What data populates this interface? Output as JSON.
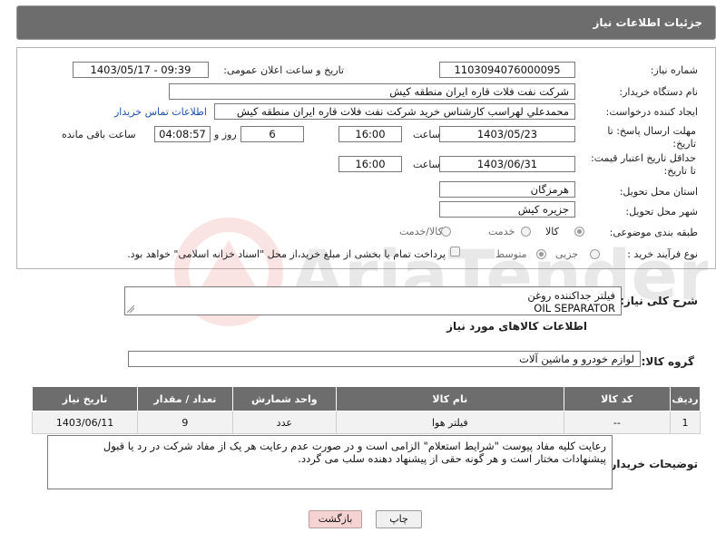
{
  "header": {
    "title": "جزئیات اطلاعات نیاز"
  },
  "form": {
    "need_number_label": "شماره نیاز:",
    "need_number": "1103094076000095",
    "announce_label": "تاریخ و ساعت اعلان عمومی:",
    "announce_value": "1403/05/17 - 09:39",
    "buyer_org_label": "نام دستگاه خریدار:",
    "buyer_org": "شرکت نفت فلات قاره ایران منطقه کیش",
    "creator_label": "ایجاد کننده درخواست:",
    "creator": "محمدعلي لهراسب كارشناس خريد شرکت نفت فلات قاره ایران منطقه کیش",
    "contact_link": "اطلاعات تماس خریدار",
    "reply_deadline_label": "مهلت ارسال پاسخ: تا تاریخ:",
    "reply_date": "1403/05/23",
    "time_word": "ساعت",
    "reply_time": "16:00",
    "days_value": "6",
    "days_and": "روز و",
    "remaining_time": "04:08:57",
    "remaining_label": "ساعت باقی مانده",
    "price_deadline_label": "حداقل تاریخ اعتبار قیمت: تا تاریخ:",
    "price_date": "1403/06/31",
    "price_time": "16:00",
    "province_label": "استان محل تحویل:",
    "province": "هرمزگان",
    "city_label": "شهر محل تحویل:",
    "city": "جزیره کیش",
    "category_label": "طبقه بندی موضوعی:",
    "category_options": [
      "کالا",
      "خدمت",
      "کالا/خدمت"
    ],
    "process_label": "نوع فرآیند خرید :",
    "process_options": [
      "جزیی",
      "متوسط"
    ],
    "payment_note": "پرداخت تمام یا بخشی از مبلغ خرید،از محل \"اسناد خزانه اسلامی\" خواهد بود."
  },
  "description": {
    "label": "شرح کلی نیاز:",
    "line1": "فیلتر جداکننده روغن",
    "line2": "OIL SEPARATOR"
  },
  "goods_info": {
    "title": "اطلاعات کالاهای مورد نیاز"
  },
  "goods_group": {
    "label": "گروه کالا:",
    "value": "لوازم خودرو و ماشین آلات"
  },
  "table": {
    "headers": [
      "ردیف",
      "کد کالا",
      "نام کالا",
      "واحد شمارش",
      "تعداد / مقدار",
      "تاریخ نیاز"
    ],
    "rows": [
      [
        "1",
        "--",
        "فیلتر هوا",
        "عدد",
        "9",
        "1403/06/11"
      ]
    ]
  },
  "buyer_notes": {
    "label": "توضیحات خریدار:",
    "line1": "رعایت کلیه مفاد  پیوست \"شرایط استعلام\" الزامی است و در صورت عدم رعایت هر یک از مفاد شرکت در رد یا قبول",
    "line2": "پیشنهادات مختار است  و هر گونه حقی از پیشنهاد دهنده سلب می گردد."
  },
  "buttons": {
    "print": "چاپ",
    "back": "بازگشت"
  },
  "watermark": {
    "text": "AriaTender.neT"
  },
  "colors": {
    "header_bg": "#6d6d6d",
    "link": "#1d4fb0",
    "back_button": "#f6d3d3"
  }
}
